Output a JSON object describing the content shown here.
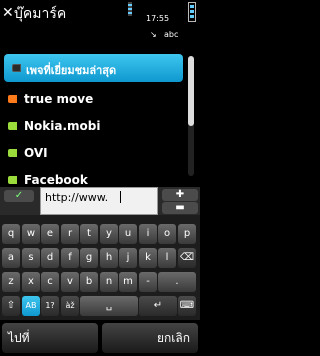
{
  "titlebar": {
    "title": "บุ๊คมาร์ค",
    "time": "17:55",
    "input_mode": "abc",
    "close_glyph": "✕",
    "input_indicator": "↘"
  },
  "bookmarks": [
    {
      "label": "เพจที่เยี่ยมชมล่าสุด",
      "icon": "history-icon",
      "color": "#000000",
      "selected": true
    },
    {
      "label": "true move",
      "icon": "bookmark-icon",
      "color": "#ff7a1a",
      "selected": false
    },
    {
      "label": "Nokia.mobi",
      "icon": "bookmark-icon",
      "color": "#9bdc3c",
      "selected": false
    },
    {
      "label": "OVI",
      "icon": "bookmark-icon",
      "color": "#9bdc3c",
      "selected": false
    },
    {
      "label": "Facebook",
      "icon": "bookmark-icon",
      "color": "#9bdc3c",
      "selected": false
    }
  ],
  "input": {
    "url_value": "http://www.",
    "ok_label": "✓",
    "plus_label": "✚",
    "minus_label": "▬"
  },
  "keyboard": {
    "row1": [
      "q",
      "w",
      "e",
      "r",
      "t",
      "y",
      "u",
      "i",
      "o",
      "p"
    ],
    "row2": [
      "a",
      "s",
      "d",
      "f",
      "g",
      "h",
      "j",
      "k",
      "l",
      "⌫"
    ],
    "row3": [
      "z",
      "x",
      "c",
      "v",
      "b",
      "n",
      "m",
      "-",
      "."
    ],
    "row4": [
      "⇧",
      "AB",
      "1?",
      "àž",
      "␣",
      "↵",
      "⌨"
    ]
  },
  "softkeys": {
    "left": "ไปที่",
    "right": "ยกเลิก"
  },
  "colors": {
    "accent": "#1eaee0",
    "background": "#000000"
  }
}
